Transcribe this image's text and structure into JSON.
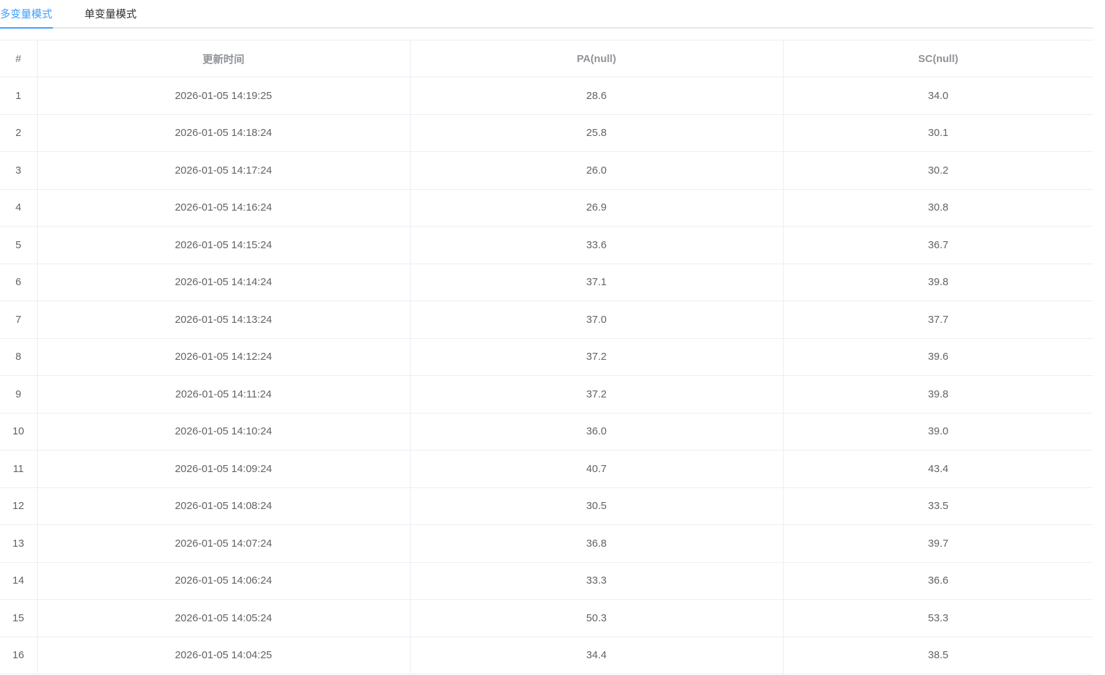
{
  "tabs": [
    {
      "label": "多变量模式",
      "active": true
    },
    {
      "label": "单变量模式",
      "active": false
    }
  ],
  "colors": {
    "accent": "#409eff",
    "header_text": "#909399",
    "cell_text": "#606266",
    "border": "#ebeef5"
  },
  "table": {
    "headers": [
      "#",
      "更新时间",
      "PA(null)",
      "SC(null)"
    ],
    "rows": [
      [
        "1",
        "2026-01-05 14:19:25",
        "28.6",
        "34.0"
      ],
      [
        "2",
        "2026-01-05 14:18:24",
        "25.8",
        "30.1"
      ],
      [
        "3",
        "2026-01-05 14:17:24",
        "26.0",
        "30.2"
      ],
      [
        "4",
        "2026-01-05 14:16:24",
        "26.9",
        "30.8"
      ],
      [
        "5",
        "2026-01-05 14:15:24",
        "33.6",
        "36.7"
      ],
      [
        "6",
        "2026-01-05 14:14:24",
        "37.1",
        "39.8"
      ],
      [
        "7",
        "2026-01-05 14:13:24",
        "37.0",
        "37.7"
      ],
      [
        "8",
        "2026-01-05 14:12:24",
        "37.2",
        "39.6"
      ],
      [
        "9",
        "2026-01-05 14:11:24",
        "37.2",
        "39.8"
      ],
      [
        "10",
        "2026-01-05 14:10:24",
        "36.0",
        "39.0"
      ],
      [
        "11",
        "2026-01-05 14:09:24",
        "40.7",
        "43.4"
      ],
      [
        "12",
        "2026-01-05 14:08:24",
        "30.5",
        "33.5"
      ],
      [
        "13",
        "2026-01-05 14:07:24",
        "36.8",
        "39.7"
      ],
      [
        "14",
        "2026-01-05 14:06:24",
        "33.3",
        "36.6"
      ],
      [
        "15",
        "2026-01-05 14:05:24",
        "50.3",
        "53.3"
      ],
      [
        "16",
        "2026-01-05 14:04:25",
        "34.4",
        "38.5"
      ]
    ]
  }
}
